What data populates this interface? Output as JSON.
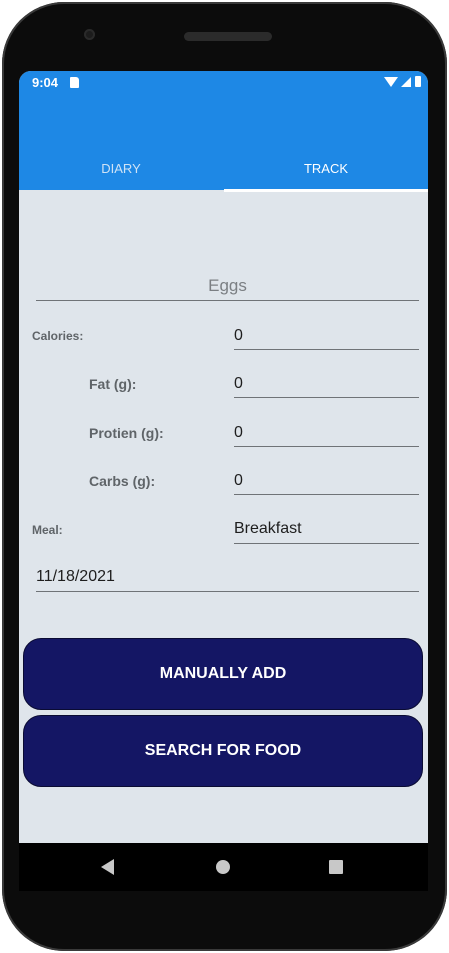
{
  "status_bar": {
    "time": "9:04",
    "icons": [
      "sd-card-icon",
      "wifi-icon",
      "signal-icon",
      "battery-icon"
    ]
  },
  "tabs": [
    {
      "label": "DIARY",
      "selected": false
    },
    {
      "label": "TRACK",
      "selected": true
    }
  ],
  "form": {
    "food_name": "Eggs",
    "calories_label": "Calories:",
    "calories_value": "0",
    "fat_label": "Fat (g):",
    "fat_value": "0",
    "protein_label": "Protien (g):",
    "protein_value": "0",
    "carbs_label": "Carbs (g):",
    "carbs_value": "0",
    "meal_label": "Meal:",
    "meal_value": "Breakfast",
    "date_value": "11/18/2021"
  },
  "buttons": {
    "manual_add": "MANUALLY ADD",
    "search_food": "SEARCH FOR FOOD"
  },
  "nav": {
    "icons": [
      "back-icon",
      "home-icon",
      "recents-icon"
    ]
  },
  "colors": {
    "primary": "#1e88e5",
    "button": "#141664",
    "background": "#dfe5eb"
  }
}
